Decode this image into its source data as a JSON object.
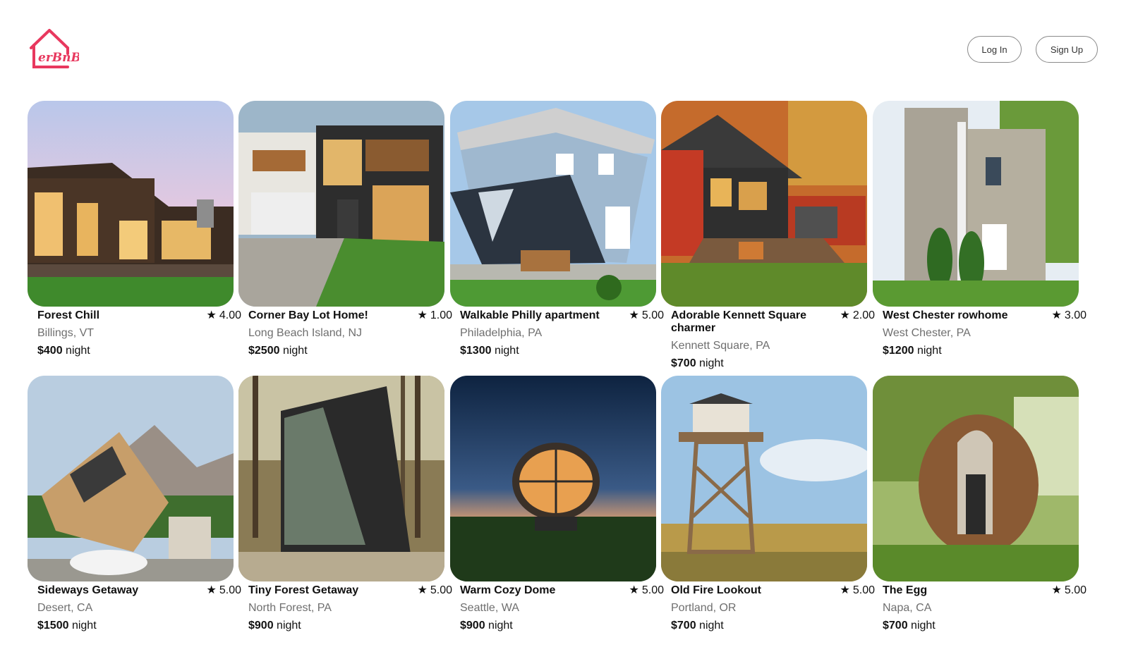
{
  "brand": {
    "logo_text": "erBnB",
    "accent": "#e8385e"
  },
  "header": {
    "login_label": "Log In",
    "signup_label": "Sign Up"
  },
  "listings": [
    {
      "title": "Forest Chill",
      "rating": "4.00",
      "location": "Billings, VT",
      "price": "$400",
      "unit": "night"
    },
    {
      "title": "Corner Bay Lot Home!",
      "rating": "1.00",
      "location": "Long Beach Island, NJ",
      "price": "$2500",
      "unit": "night"
    },
    {
      "title": "Walkable Philly apartment",
      "rating": "5.00",
      "location": "Philadelphia, PA",
      "price": "$1300",
      "unit": "night"
    },
    {
      "title": "Adorable Kennett Square charmer",
      "rating": "2.00",
      "location": "Kennett Square, PA",
      "price": "$700",
      "unit": "night"
    },
    {
      "title": "West Chester rowhome",
      "rating": "3.00",
      "location": "West Chester, PA",
      "price": "$1200",
      "unit": "night"
    },
    {
      "title": "Sideways Getaway",
      "rating": "5.00",
      "location": "Desert, CA",
      "price": "$1500",
      "unit": "night"
    },
    {
      "title": "Tiny Forest Getaway",
      "rating": "5.00",
      "location": "North Forest, PA",
      "price": "$900",
      "unit": "night"
    },
    {
      "title": "Warm Cozy Dome",
      "rating": "5.00",
      "location": "Seattle, WA",
      "price": "$900",
      "unit": "night"
    },
    {
      "title": "Old Fire Lookout",
      "rating": "5.00",
      "location": "Portland, OR",
      "price": "$700",
      "unit": "night"
    },
    {
      "title": "The Egg",
      "rating": "5.00",
      "location": "Napa, CA",
      "price": "$700",
      "unit": "night"
    }
  ]
}
